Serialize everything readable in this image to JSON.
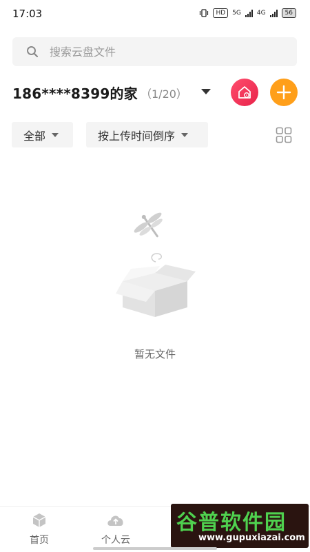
{
  "status_bar": {
    "time": "17:03",
    "hd_label": "HD",
    "net_5g": "5G",
    "net_4g": "4G",
    "battery": "56"
  },
  "search": {
    "placeholder": "搜索云盘文件",
    "value": ""
  },
  "home": {
    "title": "186****8399的家",
    "count": "（1/20）"
  },
  "filters": {
    "all_label": "全部",
    "sort_label": "按上传时间倒序"
  },
  "empty_state": {
    "text": "暂无文件"
  },
  "bottom_nav": {
    "items": [
      {
        "label": "首页",
        "icon": "cube-icon"
      },
      {
        "label": "个人云",
        "icon": "cloud-upload-icon"
      }
    ]
  },
  "watermark": {
    "main": "谷普软件园",
    "url": "www.gupuxiazai.com"
  },
  "colors": {
    "home_button": "#e8234a",
    "add_button": "#ff9f1a",
    "search_bg": "#f4f4f4"
  }
}
